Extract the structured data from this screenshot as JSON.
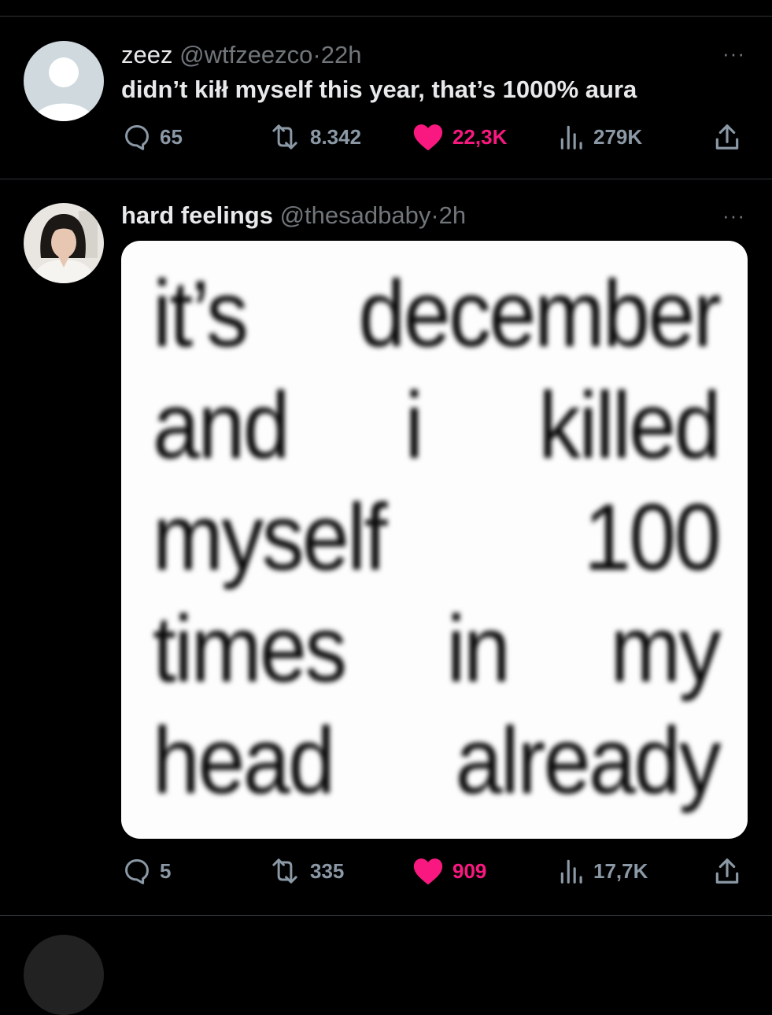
{
  "tweets": [
    {
      "name": "zeez",
      "handle": "@wtfzeezco",
      "sep": "·",
      "time": "22h",
      "more": "···",
      "text": "didn’t kiłł myself this year, that’s 1000% aura",
      "stats": {
        "replies": "65",
        "reposts": "8.342",
        "likes": "22,3K",
        "views": "279K"
      }
    },
    {
      "name": "hard feelings",
      "handle": "@thesadbaby",
      "sep": "·",
      "time": "2h",
      "more": "···",
      "image_lines": [
        [
          "it’s",
          "december"
        ],
        [
          "and",
          "i",
          "killed"
        ],
        [
          "myself",
          "100"
        ],
        [
          "times",
          "in",
          "my"
        ],
        [
          "head",
          "already"
        ]
      ],
      "stats": {
        "replies": "5",
        "reposts": "335",
        "likes": "909",
        "views": "17,7K"
      }
    }
  ],
  "icons": [
    "reply-icon",
    "repost-icon",
    "like-icon",
    "views-icon",
    "share-icon",
    "more-icon"
  ],
  "colors": {
    "background": "#000000",
    "like": "#f91880",
    "muted": "#71767b",
    "divider": "#2f3336"
  }
}
